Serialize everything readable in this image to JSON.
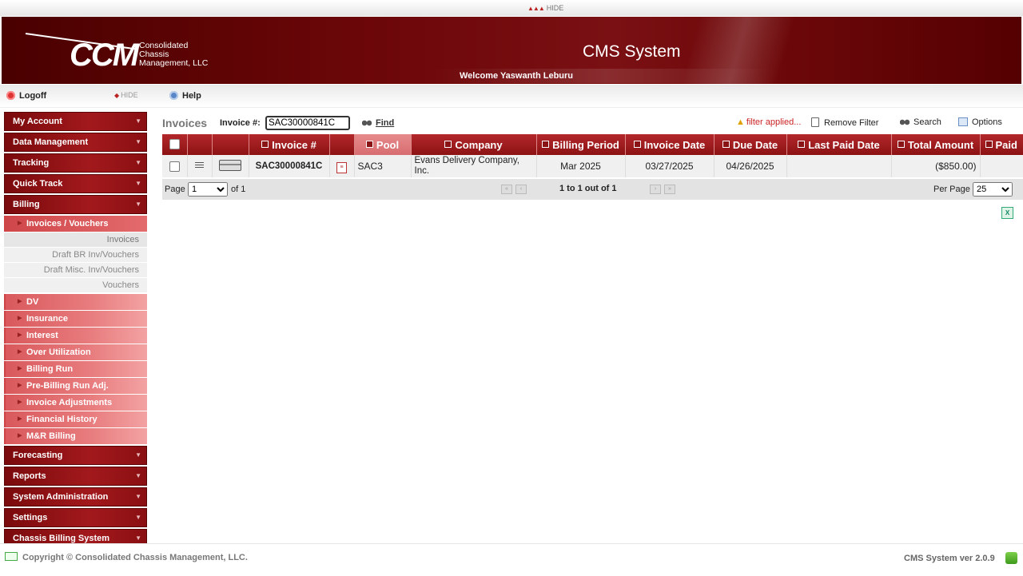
{
  "top": {
    "hide_label": "HIDE"
  },
  "banner": {
    "logo_text": "CCM",
    "company_line1": "Consolidated",
    "company_line2": "Chassis",
    "company_line3": "Management, LLC",
    "system_title": "CMS System",
    "welcome": "Welcome Yaswanth Leburu"
  },
  "toolbar": {
    "logoff": "Logoff",
    "hide": "HIDE",
    "help": "Help"
  },
  "sidebar": {
    "my_account": "My Account",
    "data_management": "Data Management",
    "tracking": "Tracking",
    "quick_track": "Quick Track",
    "billing": "Billing",
    "invoices_vouchers": "Invoices / Vouchers",
    "leaf_invoices": "Invoices",
    "leaf_draft_br": "Draft BR Inv/Vouchers",
    "leaf_draft_misc": "Draft Misc. Inv/Vouchers",
    "leaf_vouchers": "Vouchers",
    "dv": "DV",
    "insurance": "Insurance",
    "interest": "Interest",
    "over_utilization": "Over Utilization",
    "billing_run": "Billing Run",
    "pre_billing": "Pre-Billing Run Adj.",
    "invoice_adjustments": "Invoice Adjustments",
    "financial_history": "Financial History",
    "mr_billing": "M&R Billing",
    "forecasting": "Forecasting",
    "reports": "Reports",
    "system_admin": "System Administration",
    "settings": "Settings",
    "chassis_billing": "Chassis Billing System"
  },
  "main": {
    "title": "Invoices",
    "invoice_label": "Invoice #:",
    "invoice_value": "SAC30000841C",
    "find": "Find",
    "filter_applied": "filter applied...",
    "remove_filter": "Remove Filter",
    "search": "Search",
    "options": "Options"
  },
  "grid": {
    "headers": {
      "invoice": "Invoice #",
      "pool": "Pool",
      "company": "Company",
      "billing_period": "Billing Period",
      "invoice_date": "Invoice Date",
      "due_date": "Due Date",
      "last_paid_date": "Last Paid Date",
      "total_amount": "Total Amount",
      "paid": "Paid"
    },
    "rows": [
      {
        "invoice": "SAC30000841C",
        "pool": "SAC3",
        "company": "Evans Delivery Company, Inc.",
        "billing_period": "Mar 2025",
        "invoice_date": "03/27/2025",
        "due_date": "04/26/2025",
        "last_paid_date": "",
        "total_amount": "($850.00)",
        "paid": ""
      }
    ]
  },
  "pager": {
    "page_label": "Page",
    "page_value": "1",
    "of_label": "of 1",
    "count": "1 to 1 out of 1",
    "per_page_label": "Per Page",
    "per_page_value": "25"
  },
  "footer": {
    "copyright": "Copyright © Consolidated Chassis Management, LLC.",
    "version": "CMS System ver 2.0.9"
  },
  "colors": {
    "brand": "#8c1214",
    "header_red": "#b3282b",
    "submenu": "#e87c7e"
  }
}
